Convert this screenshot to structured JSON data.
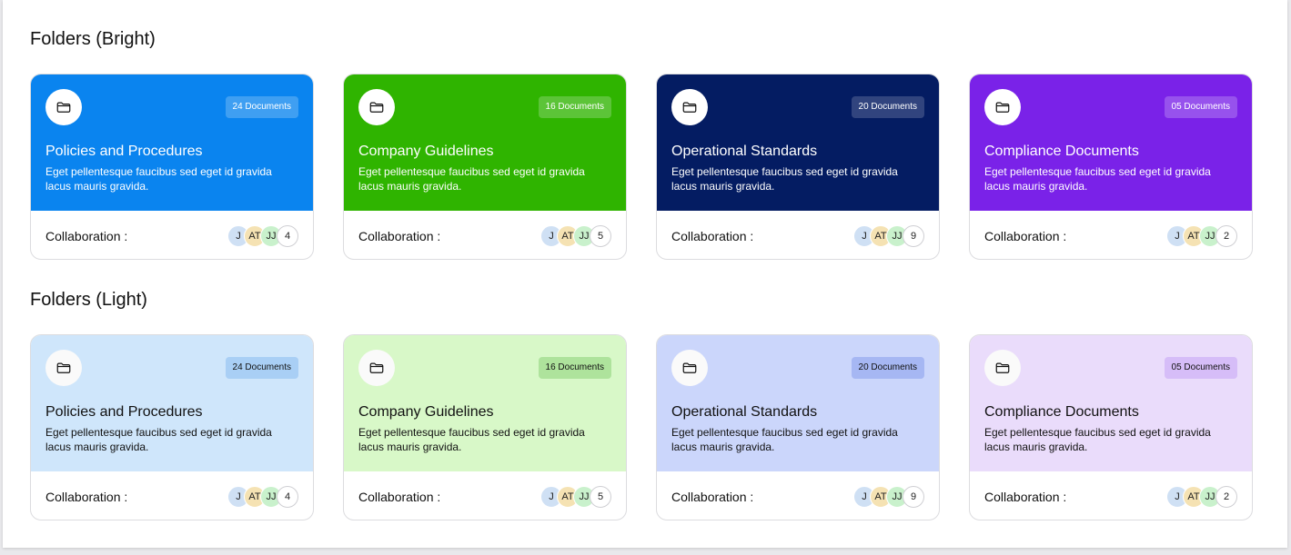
{
  "sections": [
    {
      "title": "Folders (Bright)",
      "cards": [
        {
          "title": "Policies and Procedures",
          "badge": "24 Documents",
          "desc": "Eget pellentesque faucibus sed eget id gravida lacus mauris gravida.",
          "collab_label": "Collaboration :",
          "avatars": [
            "J",
            "AT",
            "JJ"
          ],
          "count": "4",
          "icon": "folder-icon",
          "color": "#0a84ef"
        },
        {
          "title": "Company Guidelines",
          "badge": "16 Documents",
          "desc": "Eget pellentesque faucibus sed eget id gravida lacus mauris gravida.",
          "collab_label": "Collaboration :",
          "avatars": [
            "J",
            "AT",
            "JJ"
          ],
          "count": "5",
          "icon": "folder-icon",
          "color": "#2fb400"
        },
        {
          "title": "Operational Standards",
          "badge": "20 Documents",
          "desc": "Eget pellentesque faucibus sed eget id gravida lacus mauris gravida.",
          "collab_label": "Collaboration :",
          "avatars": [
            "J",
            "AT",
            "JJ"
          ],
          "count": "9",
          "icon": "folder-icon",
          "color": "#041c62"
        },
        {
          "title": "Compliance Documents",
          "badge": "05 Documents",
          "desc": "Eget pellentesque faucibus sed eget id gravida lacus mauris gravida.",
          "collab_label": "Collaboration :",
          "avatars": [
            "J",
            "AT",
            "JJ"
          ],
          "count": "2",
          "icon": "folder-icon",
          "color": "#7a22e8"
        }
      ]
    },
    {
      "title": "Folders (Light)",
      "cards": [
        {
          "title": "Policies and Procedures",
          "badge": "24 Documents",
          "desc": "Eget pellentesque faucibus sed eget id gravida lacus mauris gravida.",
          "collab_label": "Collaboration :",
          "avatars": [
            "J",
            "AT",
            "JJ"
          ],
          "count": "4",
          "icon": "folder-icon",
          "color": "#cfe6fb"
        },
        {
          "title": "Company Guidelines",
          "badge": "16 Documents",
          "desc": "Eget pellentesque faucibus sed eget id gravida lacus mauris gravida.",
          "collab_label": "Collaboration :",
          "avatars": [
            "J",
            "AT",
            "JJ"
          ],
          "count": "5",
          "icon": "folder-icon",
          "color": "#d8f8c8"
        },
        {
          "title": "Operational Standards",
          "badge": "20 Documents",
          "desc": "Eget pellentesque faucibus sed eget id gravida lacus mauris gravida.",
          "collab_label": "Collaboration :",
          "avatars": [
            "J",
            "AT",
            "JJ"
          ],
          "count": "9",
          "icon": "folder-icon",
          "color": "#cbd6fb"
        },
        {
          "title": "Compliance Documents",
          "badge": "05 Documents",
          "desc": "Eget pellentesque faucibus sed eget id gravida lacus mauris gravida.",
          "collab_label": "Collaboration :",
          "avatars": [
            "J",
            "AT",
            "JJ"
          ],
          "count": "2",
          "icon": "folder-icon",
          "color": "#eadcfb"
        }
      ]
    }
  ]
}
